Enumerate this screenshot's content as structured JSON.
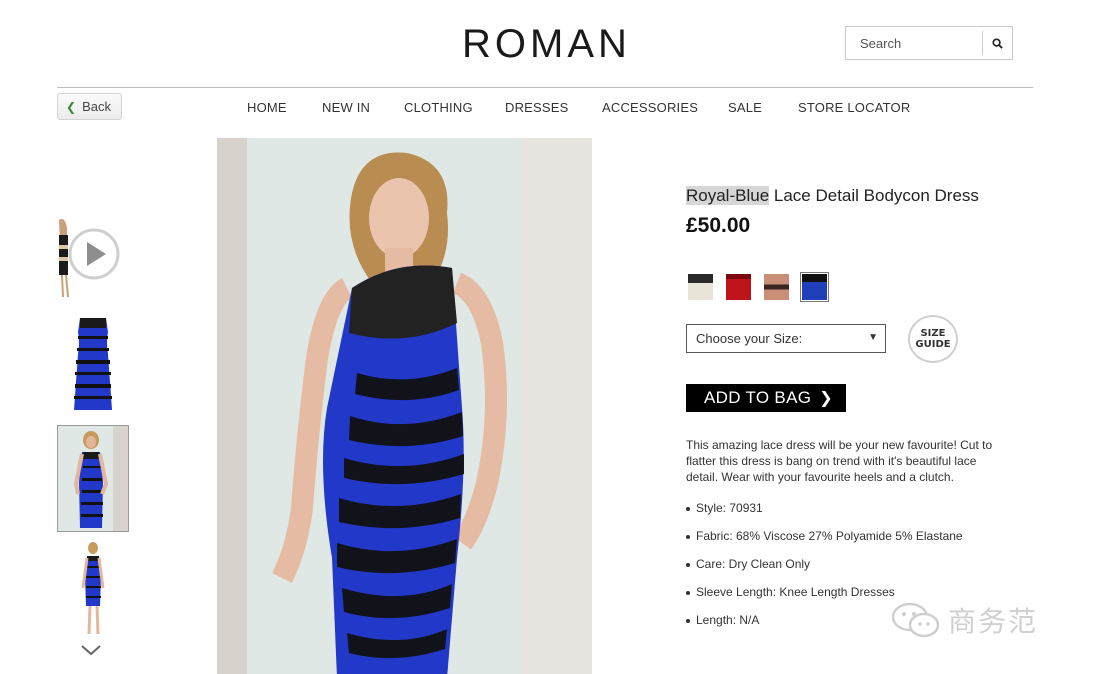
{
  "header": {
    "logo": "ROMAN",
    "search": {
      "placeholder": "Search",
      "icon": "search-icon"
    }
  },
  "back": {
    "label": "Back"
  },
  "nav": {
    "items": [
      {
        "label": "HOME"
      },
      {
        "label": "NEW IN"
      },
      {
        "label": "CLOTHING"
      },
      {
        "label": "DRESSES"
      },
      {
        "label": "ACCESSORIES"
      },
      {
        "label": "SALE"
      },
      {
        "label": "STORE LOCATOR"
      }
    ]
  },
  "gallery": {
    "thumbnails": [
      {
        "name": "video thumbnail",
        "has_play": true
      },
      {
        "name": "dress flat"
      },
      {
        "name": "model front",
        "selected": true
      },
      {
        "name": "model full length"
      }
    ],
    "scroll_icon": "chevron-down-icon"
  },
  "product": {
    "title_highlight": "Royal-Blue",
    "title_rest": " Lace Detail Bodycon Dress",
    "price": "£50.00",
    "swatches": [
      {
        "color": "#e9e4d8",
        "accent": "#2a2a2a"
      },
      {
        "color": "#c0141c",
        "accent": "#7a0a10"
      },
      {
        "color": "#c98f78",
        "accent": "#3a2520"
      },
      {
        "color": "#1f3fb8",
        "accent": "#101010",
        "selected": true
      }
    ],
    "size_select": {
      "value": "Choose your Size:"
    },
    "size_guide": {
      "line1": "SIZE",
      "line2": "GUIDE"
    },
    "add_to_bag": "ADD TO BAG",
    "description": "This amazing lace dress will be your new favourite! Cut to flatter this dress is bang on trend with it's beautiful lace detail. Wear with your favourite heels and a clutch.",
    "specs": [
      "Style: 70931",
      "Fabric: 68% Viscose 27% Polyamide 5% Elastane",
      "Care: Dry Clean Only",
      "Sleeve Length: Knee Length Dresses",
      "Length: N/A"
    ]
  },
  "watermark": {
    "text": "商务范"
  },
  "colors": {
    "dress_blue": "#2238c8",
    "lace_black": "#111111",
    "backdrop": "#dfe8e4"
  }
}
